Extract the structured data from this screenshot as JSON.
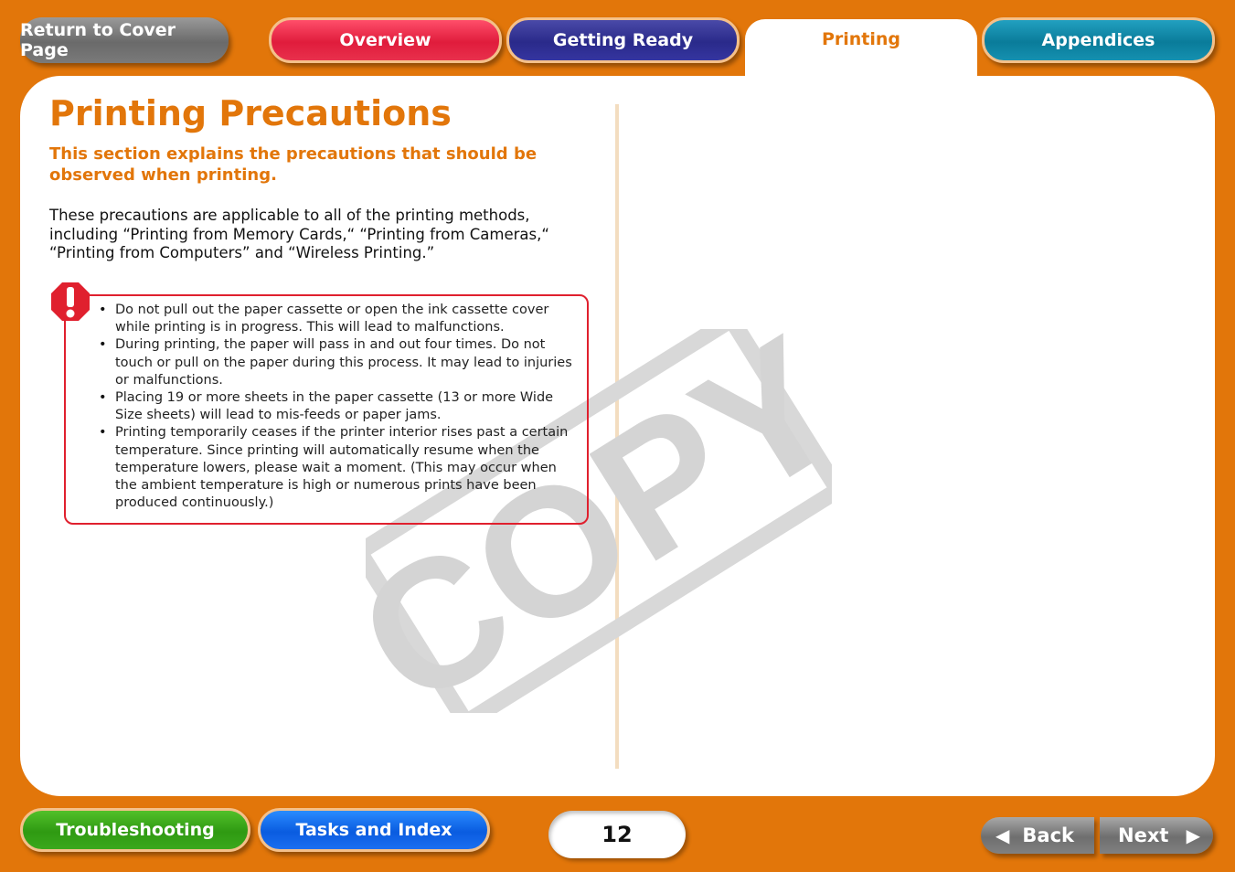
{
  "nav": {
    "cover": "Return to Cover Page",
    "tabs": [
      "Overview",
      "Getting Ready",
      "Printing",
      "Appendices"
    ]
  },
  "content": {
    "title": "Printing Precautions",
    "subtitle": "This section explains the precautions that should be observed when printing.",
    "intro": "These precautions are applicable to all of the printing methods, including “Printing from Memory Cards,“ “Printing from Cameras,“ “Printing from Computers” and “Wireless Printing.”",
    "cautions": [
      "Do not pull out the paper cassette or open the ink cassette cover while printing is in progress. This will lead to malfunctions.",
      "During printing, the paper will pass in and out four times. Do not touch or pull on the paper during this process. It may lead to injuries or malfunctions.",
      "Placing 19 or more sheets in the paper cassette (13 or more Wide Size sheets) will lead to mis-feeds or paper jams.",
      "Printing temporarily ceases if the printer interior rises past a certain temperature. Since printing will automatically resume when the temperature lowers, please wait a moment. (This may occur when the ambient temperature is high or numerous prints have been produced continuously.)"
    ],
    "watermark": "COPY"
  },
  "footer": {
    "troubleshooting": "Troubleshooting",
    "tasks": "Tasks and Index",
    "page": "12",
    "back": "Back",
    "next": "Next"
  },
  "icons": {
    "warning": "caution-exclamation-icon",
    "back": "left-triangle-arrow-icon",
    "next": "right-triangle-arrow-icon"
  },
  "colors": {
    "accent": "#e2760a",
    "overview": "#e01c3c",
    "getting_ready": "#2a2a8a",
    "appendices": "#0a7c9a",
    "troubleshooting": "#2f9a12",
    "tasks": "#0a5ce0",
    "caution_border": "#e0202e"
  }
}
